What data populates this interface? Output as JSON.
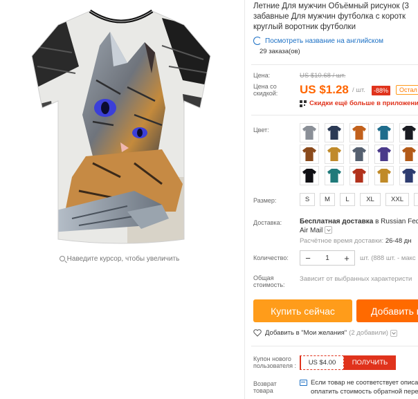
{
  "product": {
    "title_lines": [
      "Летние Для мужчин Объёмный рисунок (3",
      "забавные Для мужчин футболка с коротк",
      "круглый воротник футболки"
    ],
    "translate_link": "Посмотреть название на английском",
    "orders": "29 заказа(ов)"
  },
  "image": {
    "zoom_hint": "Наведите курсор, чтобы увеличить"
  },
  "price": {
    "label": "Цена:",
    "old": "US $10.68 / шт.",
    "discount_label": "Цена со скидкой:",
    "new": "US $1.28",
    "per_unit": "/ шт.",
    "discount_badge": "-88%",
    "remaining": "Остал",
    "app_discount": "Скидки ещё больше в приложени"
  },
  "color": {
    "label": "Цвет:",
    "swatches": [
      {
        "name": "cat",
        "color": "#8a8f97"
      },
      {
        "name": "tiger",
        "color": "#2b3a55"
      },
      {
        "name": "lion",
        "color": "#c2611c"
      },
      {
        "name": "wolf",
        "color": "#1f6d8c"
      },
      {
        "name": "dark",
        "color": "#1a1c22"
      },
      {
        "name": "tiger2",
        "color": "#8a4a1c"
      },
      {
        "name": "lion2",
        "color": "#c08a2a"
      },
      {
        "name": "wolf2",
        "color": "#556070"
      },
      {
        "name": "galaxy",
        "color": "#4a3a8a"
      },
      {
        "name": "fox",
        "color": "#b35a18"
      },
      {
        "name": "skull",
        "color": "#101014"
      },
      {
        "name": "eagle",
        "color": "#1f7a7a"
      },
      {
        "name": "fire",
        "color": "#b2321c"
      },
      {
        "name": "leopard",
        "color": "#c08a28"
      },
      {
        "name": "lion3",
        "color": "#2e3c70"
      }
    ]
  },
  "size": {
    "label": "Размер:",
    "options": [
      "S",
      "M",
      "L",
      "XL",
      "XXL",
      "3"
    ]
  },
  "shipping": {
    "label": "Доставка:",
    "free_prefix": "Бесплатная доставка",
    "via": "в Russian Fede",
    "carrier": "Air Mail",
    "time_label": "Расчётное время доставки:",
    "time_value": "26-48 дн"
  },
  "quantity": {
    "label": "Количество:",
    "minus": "−",
    "value": "1",
    "plus": "+",
    "stock": "шт. (888 шт. - макс"
  },
  "total": {
    "label": "Общая стоимость:",
    "note": "Зависит от выбранных характеристи"
  },
  "actions": {
    "buy": "Купить сейчас",
    "cart": "Добавить в"
  },
  "wishlist": {
    "label": "Добавить в \"Мои желания\"",
    "count": "(2 добавили)"
  },
  "coupon": {
    "label": "Купон нового пользователя :",
    "value": "US $4.00",
    "button": "ПОЛУЧИТЬ"
  },
  "returns": {
    "label": "Возврат товара",
    "line1": "Если товар не соответствует описа",
    "line2": "оплатить стоимость обратной пере"
  },
  "colors": {
    "accent_orange": "#ff6600",
    "buy_button": "#ff9c1a",
    "cart_button": "#ff6a00",
    "red": "#e0331c",
    "link_blue": "#1a6fc4"
  }
}
